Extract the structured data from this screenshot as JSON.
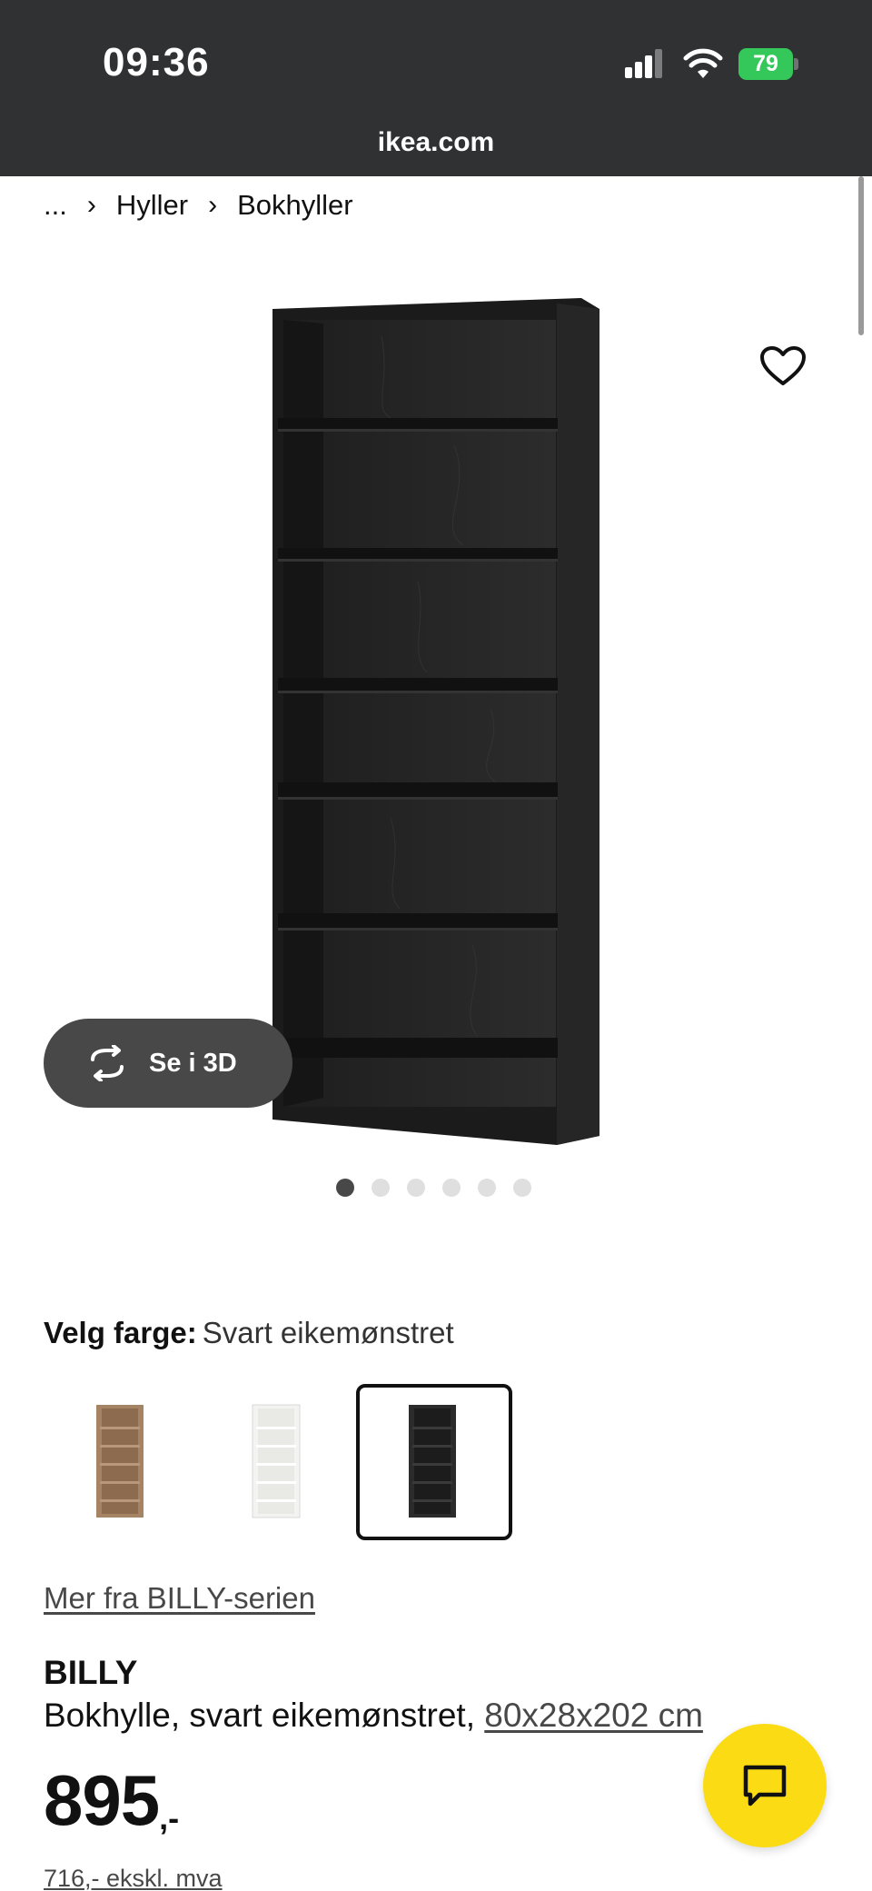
{
  "status_bar": {
    "time": "09:36",
    "battery": "79"
  },
  "browser": {
    "url": "ikea.com"
  },
  "breadcrumb": {
    "ellipsis": "...",
    "items": [
      "Hyller",
      "Bokhyller"
    ]
  },
  "gallery": {
    "view_3d_label": "Se i 3D",
    "image_count": 6,
    "active_index": 0
  },
  "color_picker": {
    "label": "Velg farge:",
    "selected": "Svart eikemønstret",
    "options": [
      {
        "name": "brown-oak",
        "color": "#a58466"
      },
      {
        "name": "white",
        "color": "#f3f3f1"
      },
      {
        "name": "black-oak",
        "color": "#2b2b2b",
        "selected": true
      }
    ]
  },
  "series_link": "Mer fra BILLY-serien",
  "product": {
    "name": "BILLY",
    "description": "Bokhylle, svart eikemønstret,",
    "dimensions": "80x28x202 cm",
    "price_main": "895",
    "price_suffix": ",-",
    "price_ex_vat": "716,- ekskl. mva"
  },
  "colors": {
    "topbar": "#2f3133",
    "chat_button": "#fadb14",
    "battery": "#34c759"
  }
}
